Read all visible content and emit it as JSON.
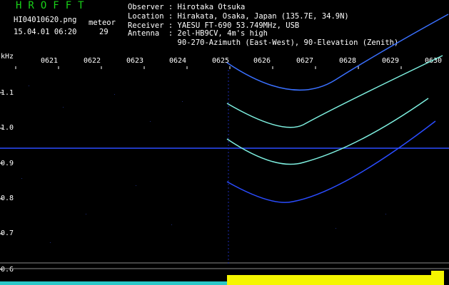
{
  "header": {
    "logo": "HROFFT",
    "filename": "HI04010620.png",
    "datetime": "15.04.01 06:20",
    "meteor_label": "meteor",
    "meteor_count": "29",
    "observer": "Observer : Hirotaka Otsuka",
    "location": "Location : Hirakata, Osaka, Japan (135.7E, 34.9N)",
    "receiver": "Receiver : YAESU FT-690 53.749MHz, USB",
    "antenna": "Antenna  : 2el-HB9CV, 4m's high",
    "antenna2": "           90-270-Azimuth (East-West), 90-Elevation (Zenith)"
  },
  "axes": {
    "unit": "kHz",
    "time_ticks": [
      "0621",
      "0622",
      "0623",
      "0624",
      "0625",
      "0626",
      "0627",
      "0628",
      "0629",
      "0630"
    ],
    "freq_ticks": [
      "1.1",
      "1.0",
      "0.9",
      "0.8",
      "0.7",
      "0.6"
    ]
  },
  "colors": {
    "logo": "#19d219",
    "trace_bright": "#7ef0e0",
    "trace_dim": "#2a4cff",
    "level_bar": "#f5f500"
  }
}
